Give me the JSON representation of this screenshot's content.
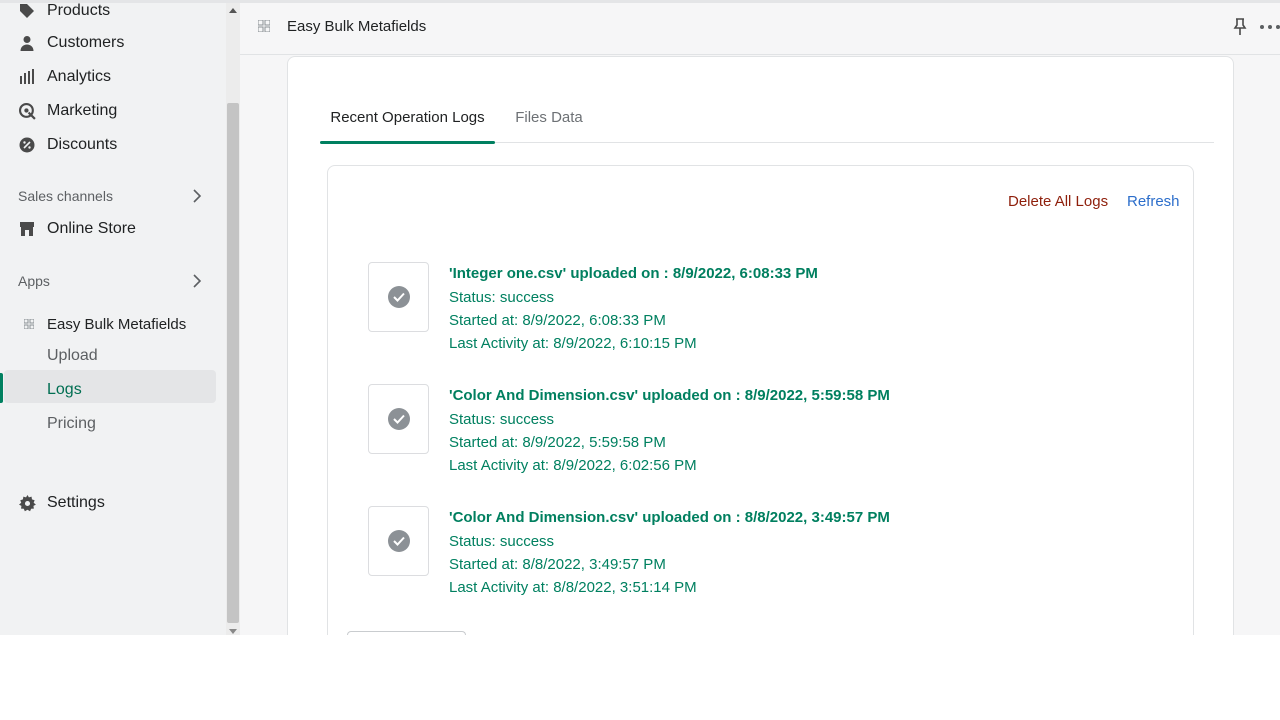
{
  "sidebar": {
    "items": [
      {
        "label": "Products",
        "icon": "tag-icon"
      },
      {
        "label": "Customers",
        "icon": "person-icon"
      },
      {
        "label": "Analytics",
        "icon": "bar-chart-icon"
      },
      {
        "label": "Marketing",
        "icon": "target-icon"
      },
      {
        "label": "Discounts",
        "icon": "discount-icon"
      }
    ],
    "sales_channels_label": "Sales channels",
    "online_store_label": "Online Store",
    "apps_label": "Apps",
    "app_name": "Easy Bulk Metafields",
    "sub_items": [
      "Upload",
      "Logs",
      "Pricing"
    ],
    "settings_label": "Settings"
  },
  "topbar": {
    "title": "Easy Bulk Metafields"
  },
  "tabs": [
    "Recent Operation Logs",
    "Files Data"
  ],
  "actions": {
    "delete_all": "Delete All Logs",
    "refresh": "Refresh"
  },
  "logs": [
    {
      "title": "'Integer one.csv' uploaded on : 8/9/2022, 6:08:33 PM",
      "status": "Status: success",
      "started": "Started at: 8/9/2022, 6:08:33 PM",
      "last_activity": "Last Activity at: 8/9/2022, 6:10:15 PM"
    },
    {
      "title": "'Color And Dimension.csv' uploaded on : 8/9/2022, 5:59:58 PM",
      "status": "Status: success",
      "started": "Started at: 8/9/2022, 5:59:58 PM",
      "last_activity": "Last Activity at: 8/9/2022, 6:02:56 PM"
    },
    {
      "title": "'Color And Dimension.csv' uploaded on : 8/8/2022, 3:49:57 PM",
      "status": "Status: success",
      "started": "Started at: 8/8/2022, 3:49:57 PM",
      "last_activity": "Last Activity at: 8/8/2022, 3:51:14 PM"
    }
  ],
  "colors": {
    "accent": "#008060",
    "log_text": "#007f5f",
    "delete": "#8e1f0b",
    "refresh": "#2c6ecb"
  }
}
